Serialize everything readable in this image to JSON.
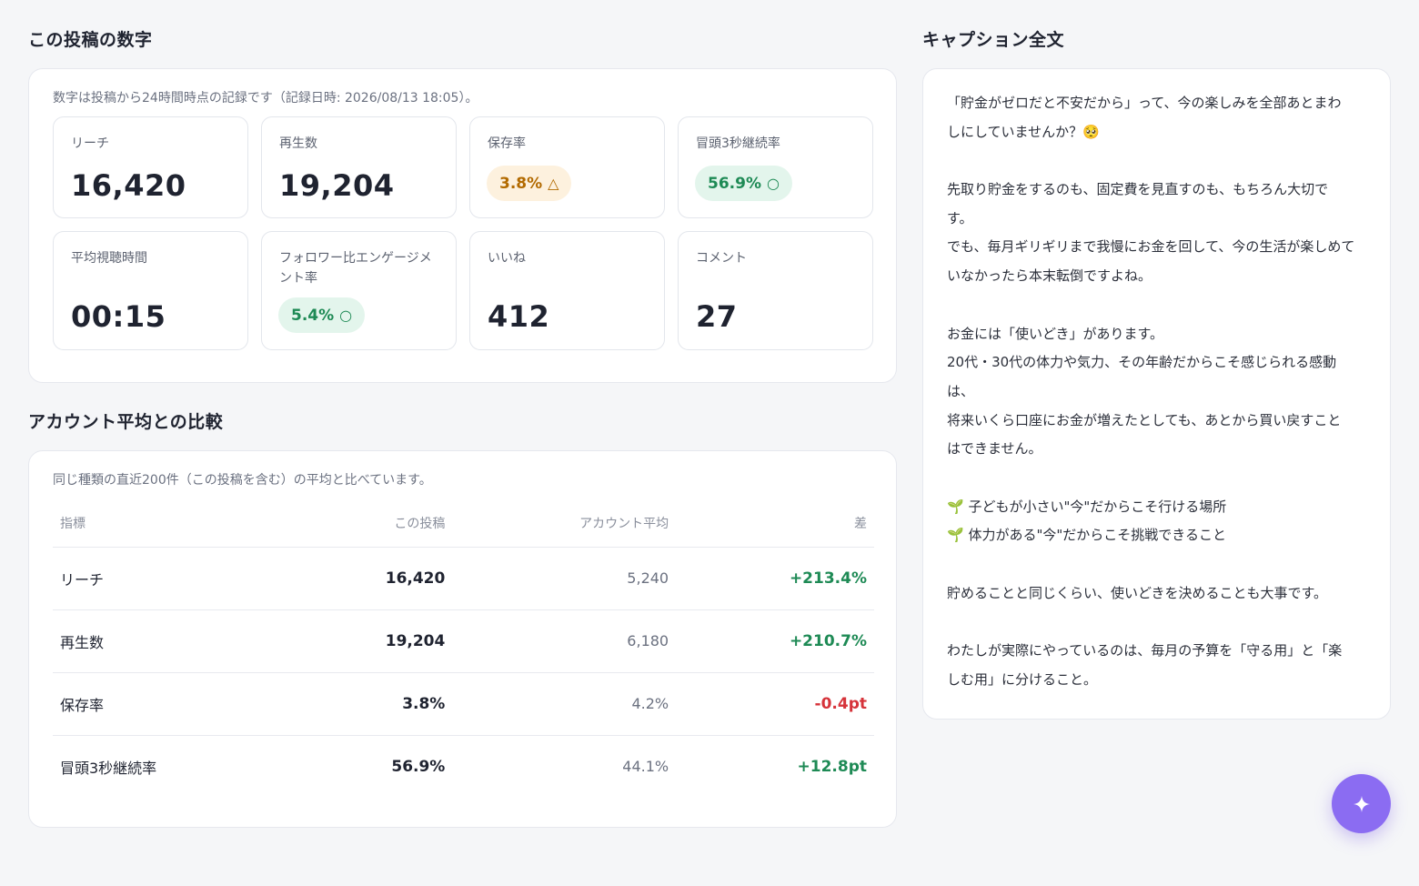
{
  "metrics": {
    "title": "この投稿の数字",
    "note": "数字は投稿から24時間時点の記録です（記録日時: 2026/08/13 18:05）。",
    "tiles": [
      {
        "label": "リーチ",
        "value": "16,420"
      },
      {
        "label": "再生数",
        "value": "19,204"
      },
      {
        "label": "保存率",
        "value": "3.8%",
        "status": "△",
        "status_color": "#b26a00"
      },
      {
        "label": "冒頭3秒継続率",
        "value": "56.9%",
        "status": "○",
        "status_color": "#1e8a55"
      },
      {
        "label": "平均視聴時間",
        "value": "00:15"
      },
      {
        "label": "フォロワー比エンゲージメント率",
        "label_line1": "フォロワー比エンゲージメ",
        "label_line2": "ント率",
        "value": "5.4%",
        "status": "○",
        "status_color": "#1e8a55"
      },
      {
        "label": "いいね",
        "value": "412"
      },
      {
        "label": "コメント",
        "value": "27"
      }
    ]
  },
  "comparison": {
    "title": "アカウント平均との比較",
    "note": "同じ種類の直近200件（この投稿を含む）の平均と比べています。",
    "headers": [
      "指標",
      "この投稿",
      "アカウント平均",
      "差"
    ],
    "rows": [
      {
        "metric": "リーチ",
        "this_post": "16,420",
        "average": "5,240",
        "diff": "+213.4%",
        "diff_color": "#1e8a55"
      },
      {
        "metric": "再生数",
        "this_post": "19,204",
        "average": "6,180",
        "diff": "+210.7%",
        "diff_color": "#1e8a55"
      },
      {
        "metric": "保存率",
        "this_post": "3.8%",
        "average": "4.2%",
        "diff": "-0.4pt",
        "diff_color": "#d6333a"
      },
      {
        "metric": "冒頭3秒継続率",
        "this_post": "56.9%",
        "average": "44.1%",
        "diff": "+12.8pt",
        "diff_color": "#1e8a55"
      }
    ]
  },
  "caption": {
    "title": "キャプション全文",
    "lines": [
      "「貯金がゼロだと不安だから」って、今の楽しみを全部あとまわ",
      "しにしていませんか？🥺",
      "",
      "先取り貯金をするのも、固定費を見直すのも、もちろん大切で",
      "す。",
      "でも、毎月ギリギリまで我慢にお金を回して、今の生活が楽しめて",
      "いなかったら本末転倒ですよね。",
      "",
      "お金には「使いどき」があります。",
      "20代・30代の体力や気力、その年齢だからこそ感じられる感動",
      "は、",
      "将来いくら口座にお金が増えたとしても、あとから買い戻すこと",
      "はできません。",
      "",
      "🌱 子どもが小さい\"今\"だからこそ行ける場所",
      "🌱 体力がある\"今\"だからこそ挑戦できること",
      "",
      "貯めることと同じくらい、使いどきを決めることも大事です。",
      "",
      "わたしが実際にやっているのは、毎月の予算を「守る用」と「楽",
      "しむ用」に分けること。"
    ]
  },
  "fab": {
    "icon": "sparkle-icon",
    "color": "#8b6cf2"
  }
}
